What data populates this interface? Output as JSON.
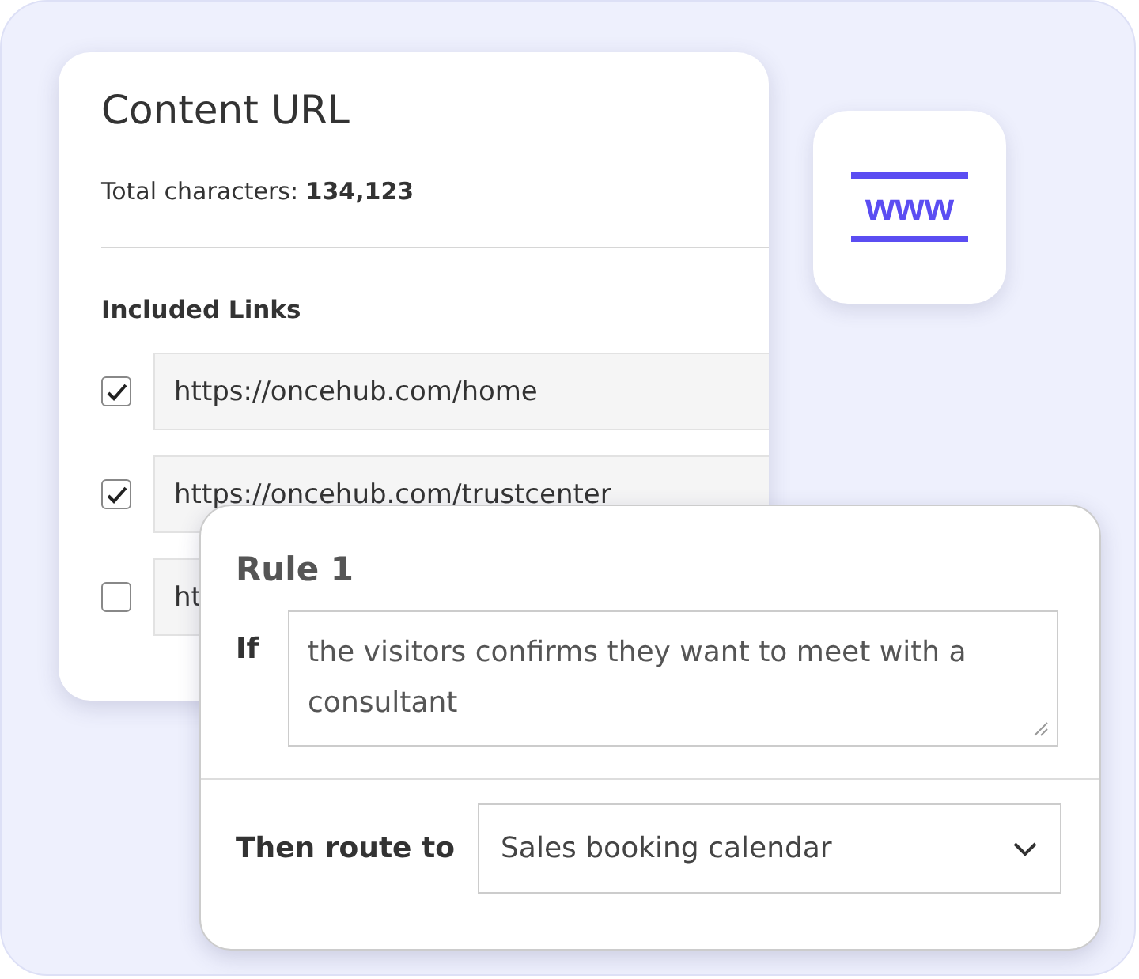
{
  "content_card": {
    "title": "Content URL",
    "total": "Total characters: **134,123**",
    "links_heading": "Included Links",
    "links": [
      {
        "url": "https://oncehub.com/home",
        "checked": true
      },
      {
        "url": "https://oncehub.com/trustcenter",
        "checked": true
      },
      {
        "url": "ht",
        "checked": false
      }
    ]
  },
  "www_tile": {
    "label": "www"
  },
  "rule_card": {
    "title": "Rule 1",
    "if_label": "If",
    "condition": "the visitors confirms they want to meet with a consultant",
    "route_label": "Then route to",
    "destination": "Sales booking calendar"
  }
}
